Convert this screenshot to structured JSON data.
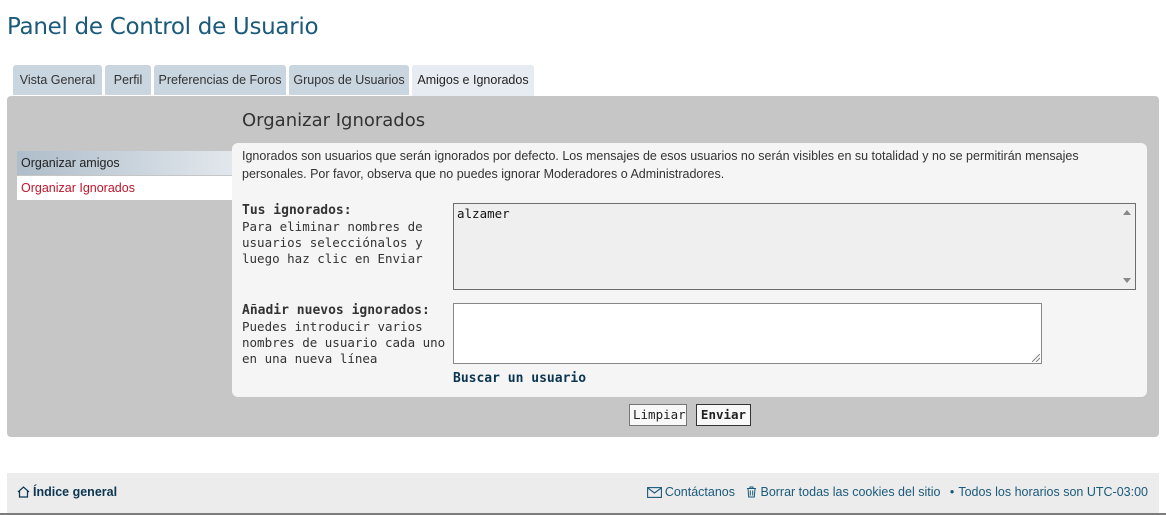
{
  "page": {
    "title": "Panel de Control de Usuario"
  },
  "tabs": [
    {
      "label": "Vista General",
      "active": false
    },
    {
      "label": "Perfil",
      "active": false
    },
    {
      "label": "Preferencias de Foros",
      "active": false
    },
    {
      "label": "Grupos de Usuarios",
      "active": false
    },
    {
      "label": "Amigos e Ignorados",
      "active": true
    }
  ],
  "sidebar": {
    "items": [
      {
        "label": "Organizar amigos",
        "active": false
      },
      {
        "label": "Organizar Ignorados",
        "active": true
      }
    ]
  },
  "main": {
    "section_title": "Organizar Ignorados",
    "intro": "Ignorados son usuarios que serán ignorados por defecto. Los mensajes de esos usuarios no serán visibles en su totalidad y no se permitirán mensajes personales. Por favor, observa que no puedes ignorar Moderadores o Administradores.",
    "ignored_field": {
      "label": "Tus ignorados:",
      "help": "Para eliminar nombres de usuarios selecciónalos y luego haz clic en Enviar",
      "options": [
        "alzamer"
      ]
    },
    "add_field": {
      "label": "Añadir nuevos ignorados:",
      "help": "Puedes introducir varios nombres de usuario cada uno en una nueva línea",
      "value": ""
    },
    "search_link": "Buscar un usuario",
    "buttons": {
      "clear": "Limpiar",
      "submit": "Enviar"
    }
  },
  "footer": {
    "home_link": "Índice general",
    "contact": "Contáctanos",
    "delete_cookies": "Borrar todas las cookies del sitio",
    "timezone": "Todos los horarios son UTC-03:00"
  },
  "colors": {
    "title": "#1a5a7a",
    "active_side_item": "#c0162c",
    "panel_bg": "#c6c6c6",
    "tab_bg": "#c9d5df"
  }
}
